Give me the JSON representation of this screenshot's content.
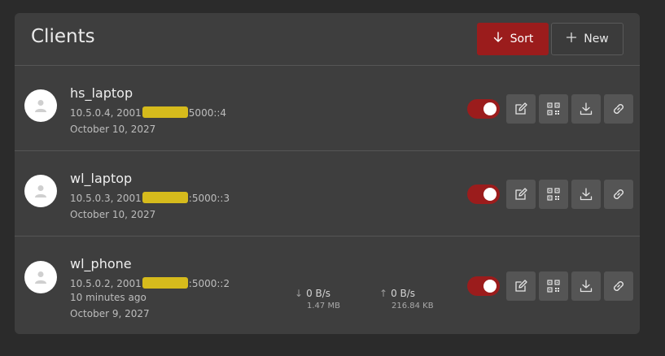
{
  "panel": {
    "title": "Clients",
    "sort_label": "Sort",
    "new_label": "New"
  },
  "clients": [
    {
      "name": "hs_laptop",
      "addr_prefix": "10.5.0.4, 2001",
      "addr_suffix": "5000::4",
      "date": "October 10, 2027",
      "enabled": true
    },
    {
      "name": "wl_laptop",
      "addr_prefix": "10.5.0.3, 2001",
      "addr_suffix": ":5000::3",
      "date": "October 10, 2027",
      "enabled": true
    },
    {
      "name": "wl_phone",
      "addr_prefix": "10.5.0.2, 2001",
      "addr_suffix": ":5000::2",
      "handshake": "10 minutes ago",
      "date": "October 9, 2027",
      "enabled": true,
      "download_rate": "0 B/s",
      "download_total": "1.47 MB",
      "upload_rate": "0 B/s",
      "upload_total": "216.84 KB"
    }
  ],
  "icons": {
    "sort": "arrow-down-icon",
    "new": "plus-icon",
    "avatar": "user-icon",
    "edit": "edit-icon",
    "qr": "qr-code-icon",
    "download": "download-icon",
    "link": "link-icon"
  },
  "colors": {
    "accent": "#9b1c1c",
    "background": "#2b2b2b",
    "panel": "#3e3e3e",
    "redaction": "#d6bb1c"
  }
}
